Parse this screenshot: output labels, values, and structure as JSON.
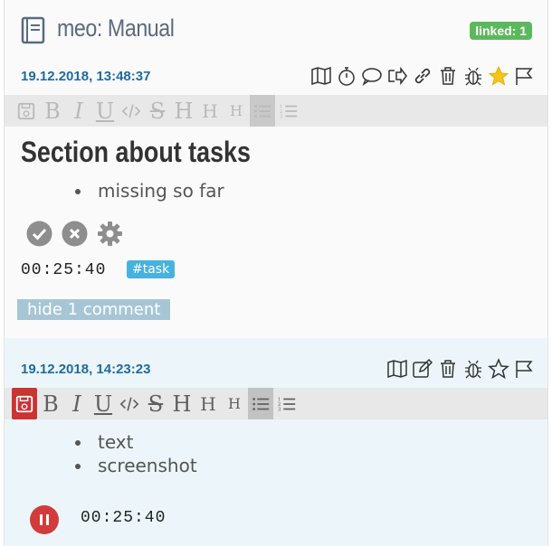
{
  "entry": {
    "title": "meo: Manual",
    "linked_badge": "linked: 1",
    "datetime": "19.12.2018, 13:48:37",
    "content_heading": "Section about tasks",
    "content_items": [
      "missing so far"
    ],
    "timer": "00:25:40",
    "tag": "#task",
    "hide_comments_label": "hide 1 comment",
    "actions": [
      "map-icon",
      "stopwatch-icon",
      "comment-icon",
      "share-icon",
      "link-icon",
      "trash-icon",
      "bug-icon",
      "star-icon",
      "flag-icon"
    ],
    "star_color": "#f5c518"
  },
  "toolbar": {
    "buttons": [
      "save",
      "B",
      "I",
      "U",
      "code",
      "S",
      "H",
      "H",
      "H",
      "bullet-list",
      "numbered-list"
    ]
  },
  "comment": {
    "datetime": "19.12.2018, 14:23:23",
    "items": [
      "text",
      "screenshot"
    ],
    "timer": "00:25:40",
    "actions": [
      "map-icon",
      "edit-icon",
      "trash-icon",
      "bug-icon",
      "star-icon",
      "flag-icon"
    ]
  },
  "colors": {
    "accent_blue": "#1f6aa3",
    "badge_green": "#5cb85c",
    "tag_blue": "#47b2e0",
    "save_red": "#cc3333",
    "comment_bg": "#ecf6fa"
  }
}
